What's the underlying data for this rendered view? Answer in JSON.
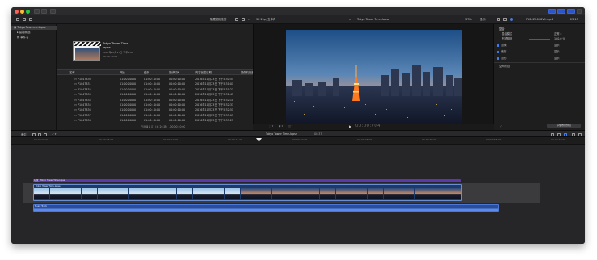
{
  "window": {
    "title": "Tokyo Tower Time-lapse"
  },
  "toolbar": {
    "browser_label": "隐藏被拒绝的",
    "format": "3K 25p, 立体声",
    "viewer_title": "Tokyo Tower Time-lapse",
    "viewer_zoom": "37%",
    "viewer_display": "显示",
    "inspector_clip": "PAS4ZQ6H8V9.mp4",
    "inspector_time": "23:13"
  },
  "sidebar": {
    "items": [
      {
        "label": "Tokyo Tow...me-lapse"
      },
      {
        "label": "智能精选"
      },
      {
        "label": "事件名"
      }
    ]
  },
  "browser": {
    "clip_title": "Tokyo Tower Time-lapse",
    "clip_meta1": "2017年10月17日 下午1:00",
    "clip_meta2": "00:00:40:00",
    "columns": [
      "名称",
      "开始",
      "结束",
      "持续时间",
      "内容创建日期",
      "摄像机角度"
    ],
    "rows": [
      [
        "P1047830",
        "01:00:00:00",
        "01:00:10:00",
        "00:00:10:00",
        "2016年10月23日 下午5:30:54",
        ""
      ],
      [
        "P1047831",
        "01:00:00:00",
        "01:00:10:00",
        "00:00:10:00",
        "2016年10月23日 下午5:31:01",
        ""
      ],
      [
        "P1047832",
        "01:00:00:00",
        "01:00:10:00",
        "00:00:10:00",
        "2016年10月23日 下午5:31:23",
        ""
      ],
      [
        "P1047833",
        "01:00:00:00",
        "01:00:10:00",
        "00:00:10:00",
        "2016年10月23日 下午5:31:45",
        ""
      ],
      [
        "P1047834",
        "01:00:00:00",
        "01:00:10:00",
        "00:00:10:00",
        "2016年10月23日 下午5:32:10",
        ""
      ],
      [
        "P1047835",
        "01:00:00:00",
        "01:00:10:00",
        "00:00:10:00",
        "2016年10月23日 下午5:32:33",
        ""
      ],
      [
        "P1047836",
        "01:00:00:00",
        "01:00:10:00",
        "00:00:10:00",
        "2016年10月23日 下午5:32:51",
        ""
      ],
      [
        "P1047837",
        "01:00:00:00",
        "01:00:10:00",
        "00:00:10:00",
        "2016年10月23日 下午5:33:05",
        ""
      ],
      [
        "P1047838",
        "01:00:00:00",
        "01:00:10:00",
        "00:00:10:00",
        "2016年10月23日 下午5:33:25",
        ""
      ]
    ],
    "footer": "已选择 1 项（共 26 项）, 00:00:10:00"
  },
  "viewer": {
    "timecode": "00:00:704",
    "controls": [
      "撤销",
      "重做"
    ]
  },
  "inspector": {
    "section_title": "复合",
    "rows": [
      {
        "label": "混合模式",
        "value": "正常 ◊"
      },
      {
        "label": "不透明度",
        "value": "100.0 %"
      }
    ],
    "checkboxes": [
      {
        "label": "变换",
        "value": "显示"
      },
      {
        "label": "裁剪",
        "value": "显示"
      },
      {
        "label": "变形",
        "value": "显示"
      }
    ],
    "extra": "空间符合",
    "save_button": "存储效果预置"
  },
  "timeline": {
    "label_index": "索引",
    "title": "Tokyo Tower Time-lapse",
    "duration": "00:37",
    "ruler": [
      "00:00:00:00",
      "00:00:05:00",
      "00:00:10:00",
      "00:00:15:00",
      "00:00:20:00",
      "00:00:25:00",
      "00:00:30:00",
      "00:00:35:00",
      "00:00:40:00"
    ],
    "title_clip": "标题：Tokyo Tower Time-lapse",
    "video_clip": "Tokyo Tower Time-lapse",
    "audio_clip": "Music Track"
  }
}
